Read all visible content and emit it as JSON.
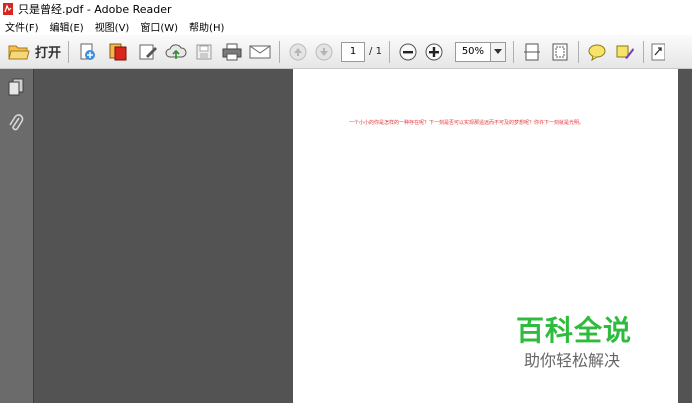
{
  "window": {
    "title": "只是曾经.pdf - Adobe Reader"
  },
  "menu": [
    "文件(F)",
    "编辑(E)",
    "视图(V)",
    "窗口(W)",
    "帮助(H)"
  ],
  "toolbar": {
    "open_label": "打开",
    "page_current": "1",
    "page_total": "/ 1",
    "zoom": "50%"
  },
  "document": {
    "text": "一个小小的你是怎样的一种存在呢？下一刻是否可以实现那遥远而不可及的梦想呢？你许下一刻就是光明。"
  },
  "watermark": {
    "title": "百科全说",
    "subtitle": "助你轻松解决"
  },
  "colors": {
    "doc_text": "#e0383a",
    "watermark_green": "#2fbc3e",
    "workspace": "#535353",
    "side_panel": "#6b6b6b"
  },
  "icons": [
    "pdf-app-icon",
    "folder-open-icon",
    "create-pdf-icon",
    "combine-icon",
    "edit-icon",
    "cloud-upload-icon",
    "save-icon",
    "print-icon",
    "email-icon",
    "prev-page-icon",
    "next-page-icon",
    "zoom-out-icon",
    "zoom-in-icon",
    "fit-width-icon",
    "fit-page-icon",
    "comment-icon",
    "highlight-icon",
    "expand-icon",
    "pages-panel-icon",
    "attachment-icon"
  ]
}
